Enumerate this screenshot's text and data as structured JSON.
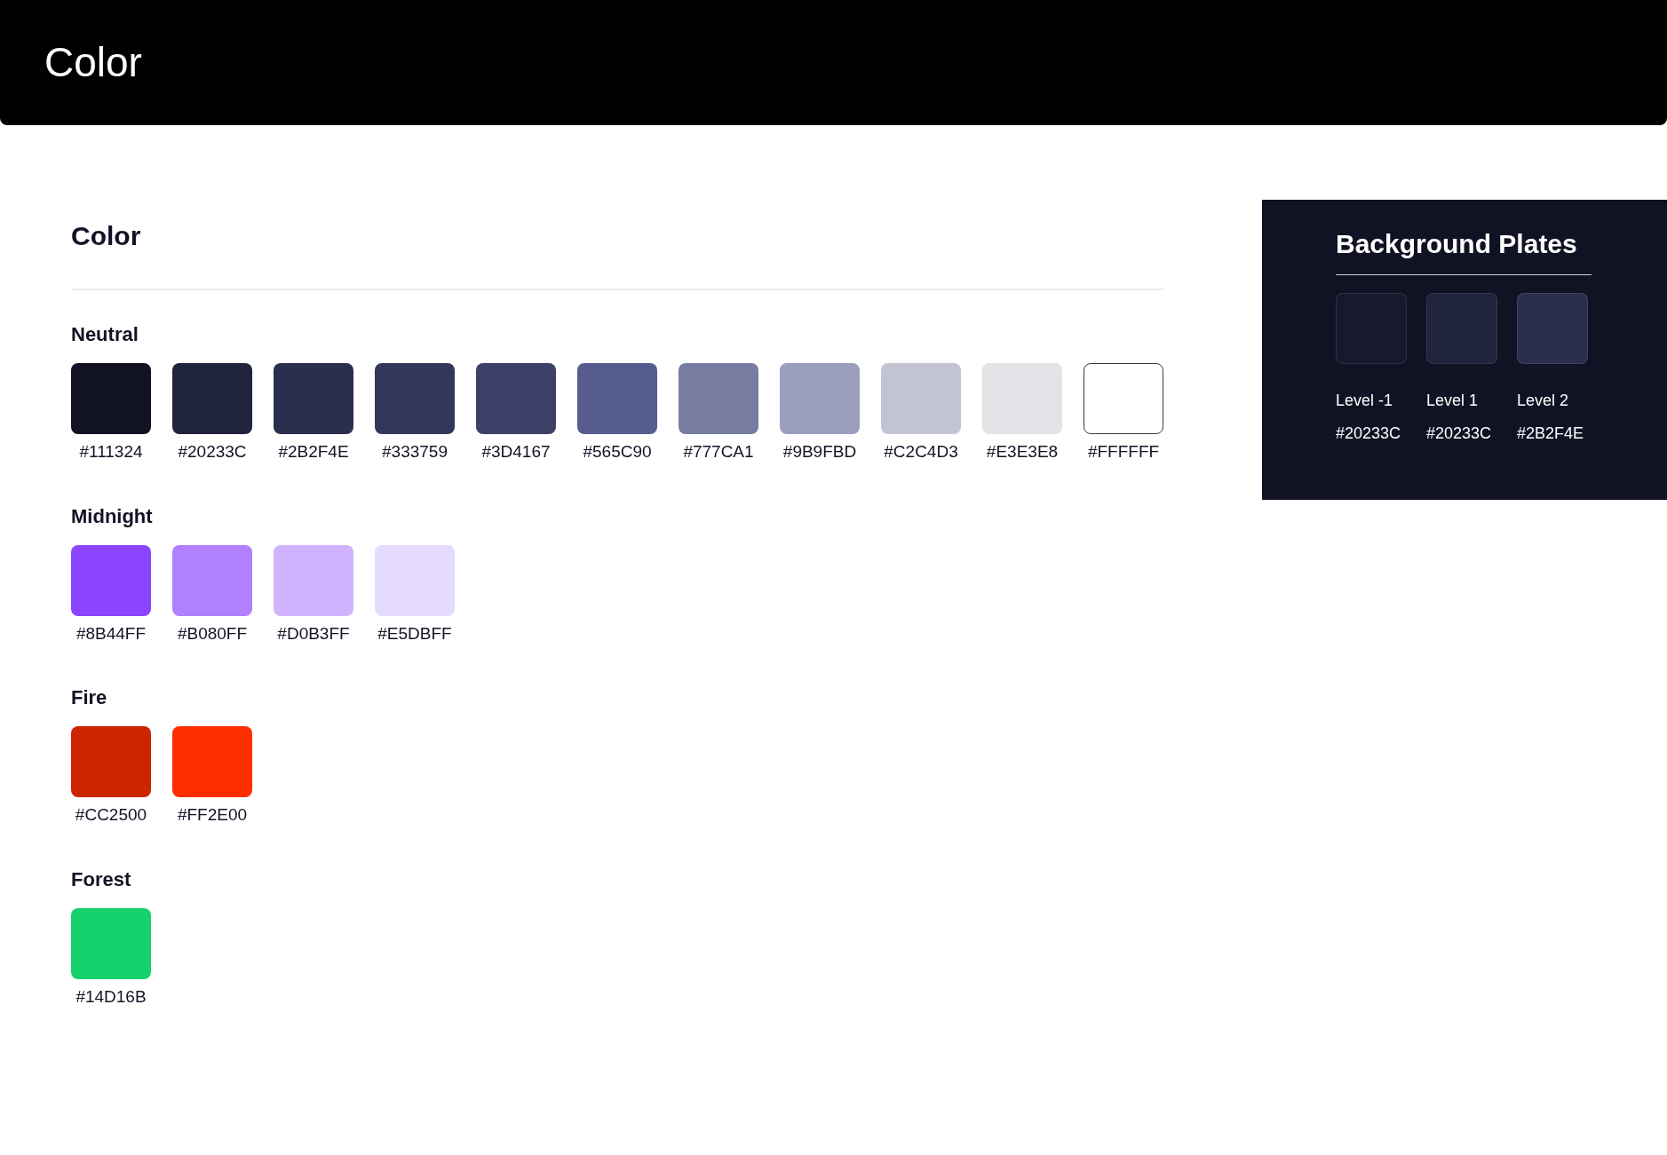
{
  "header": {
    "title": "Color"
  },
  "section": {
    "title": "Color",
    "groups": [
      {
        "name": "Neutral",
        "swatches": [
          {
            "label": "#111324",
            "color": "#111324",
            "outlined": false
          },
          {
            "label": "#20233C",
            "color": "#20233c",
            "outlined": false
          },
          {
            "label": "#2B2F4E",
            "color": "#2b2f4e",
            "outlined": false
          },
          {
            "label": "#333759",
            "color": "#333759",
            "outlined": false
          },
          {
            "label": "#3D4167",
            "color": "#3d4167",
            "outlined": false
          },
          {
            "label": "#565C90",
            "color": "#565c90",
            "outlined": false
          },
          {
            "label": "#777CA1",
            "color": "#777ca1",
            "outlined": false
          },
          {
            "label": "#9B9FBD",
            "color": "#9b9fbd",
            "outlined": false
          },
          {
            "label": "#C2C4D3",
            "color": "#c2c4d3",
            "outlined": false
          },
          {
            "label": "#E3E3E8",
            "color": "#e3e3e8",
            "outlined": false
          },
          {
            "label": "#FFFFFF",
            "color": "#ffffff",
            "outlined": true
          }
        ]
      },
      {
        "name": "Midnight",
        "swatches": [
          {
            "label": "#8B44FF",
            "color": "#8b44ff",
            "outlined": false
          },
          {
            "label": "#B080FF",
            "color": "#b080ff",
            "outlined": false
          },
          {
            "label": "#D0B3FF",
            "color": "#d0b3ff",
            "outlined": false
          },
          {
            "label": "#E5DBFF",
            "color": "#e5dbff",
            "outlined": false
          }
        ]
      },
      {
        "name": "Fire",
        "swatches": [
          {
            "label": "#CC2500",
            "color": "#cc2500",
            "outlined": false
          },
          {
            "label": "#FF2E00",
            "color": "#ff2e00",
            "outlined": false
          }
        ]
      },
      {
        "name": "Forest",
        "swatches": [
          {
            "label": "#14D16B",
            "color": "#14d16b",
            "outlined": false
          }
        ]
      }
    ]
  },
  "plates": {
    "title": "Background Plates",
    "items": [
      {
        "level": "Level -1",
        "label": "#20233C",
        "color": "#161a2c"
      },
      {
        "level": "Level 1",
        "label": "#20233C",
        "color": "#1f233c"
      },
      {
        "level": "Level 2",
        "label": "#2B2F4E",
        "color": "#2b2f4e"
      }
    ]
  }
}
